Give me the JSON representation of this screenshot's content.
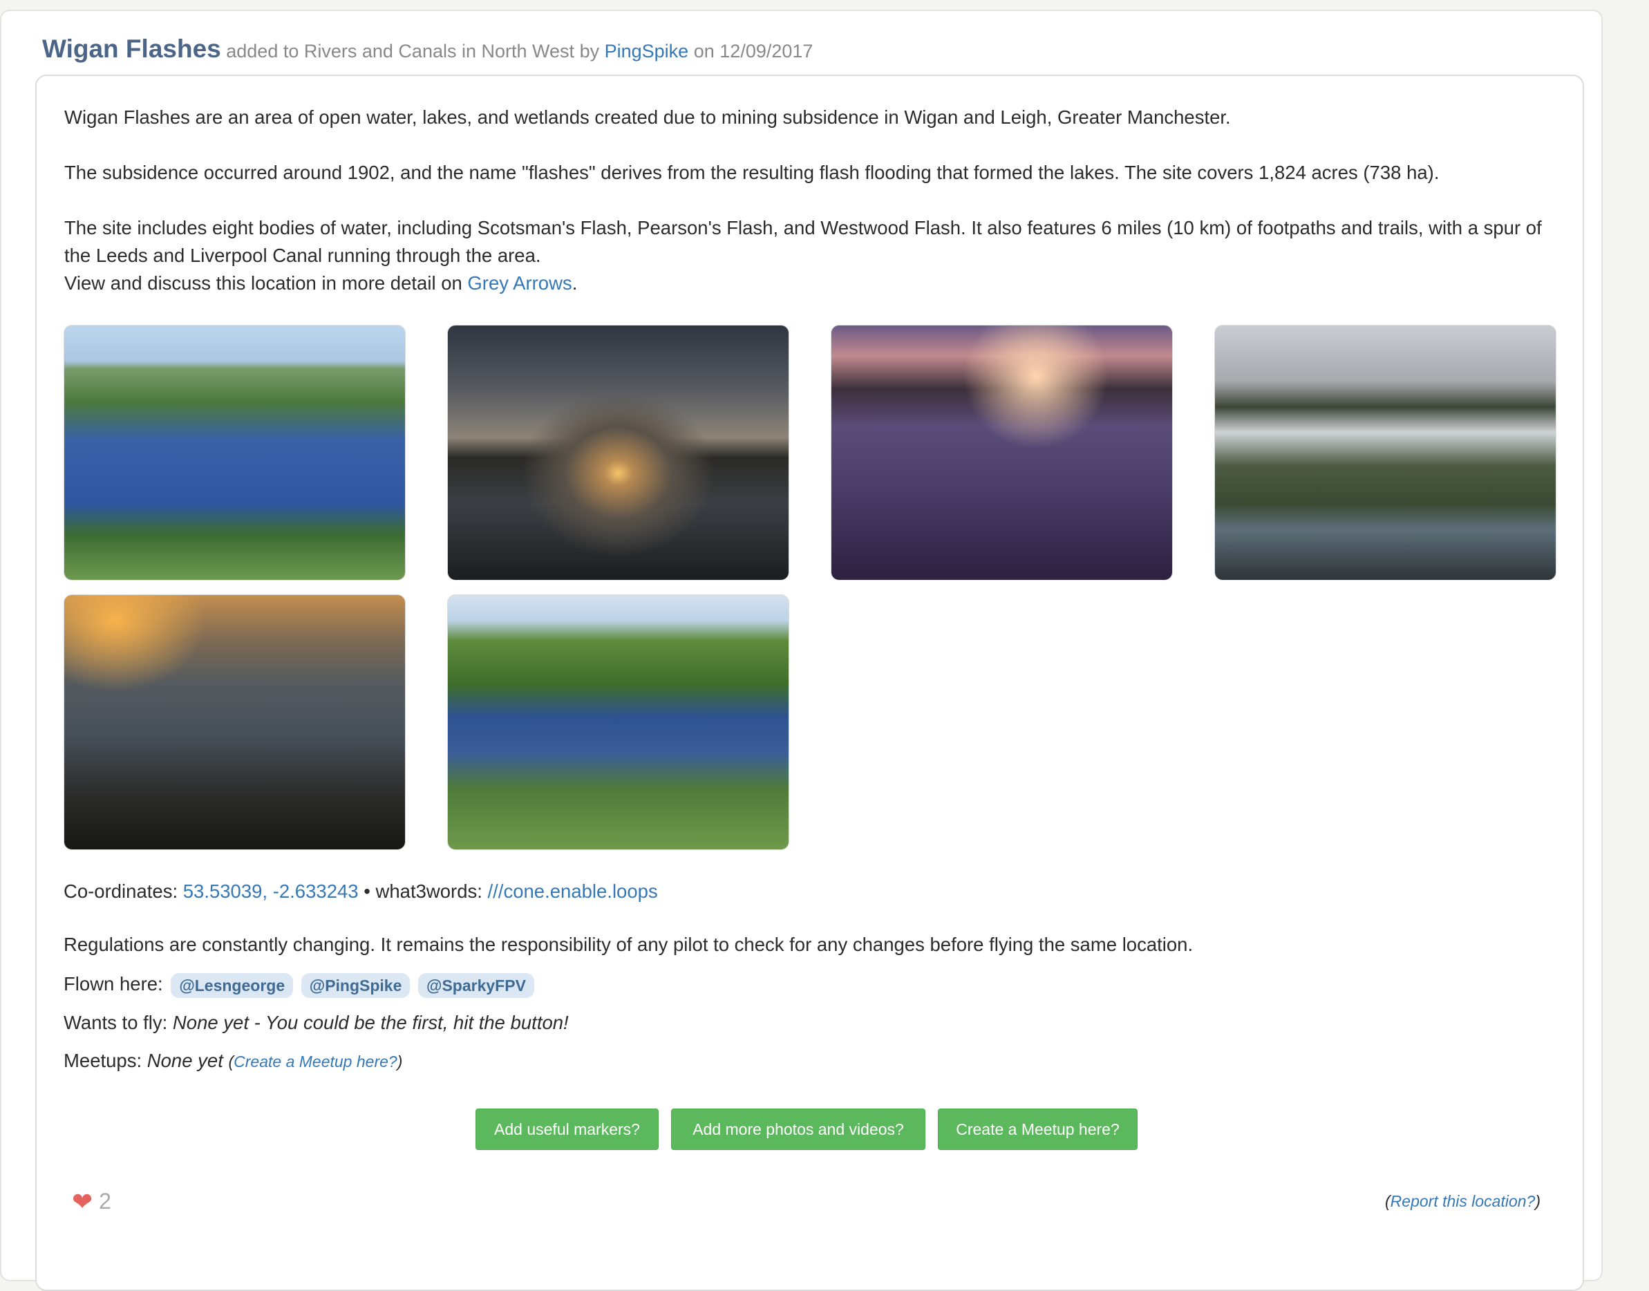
{
  "header": {
    "title": "Wigan Flashes",
    "added_to_prefix": "added to",
    "category": "Rivers and Canals in North West",
    "by_text": "by",
    "author": "PingSpike",
    "on_text": "on",
    "date": "12/09/2017"
  },
  "description": {
    "p1": "Wigan Flashes are an area of open water, lakes, and wetlands created due to mining subsidence in Wigan and Leigh, Greater Manchester.",
    "p2": "The subsidence occurred around 1902, and the name \"flashes\" derives from the resulting flash flooding that formed the lakes. The site covers 1,824 acres (738 ha).",
    "p3": "The site includes eight bodies of water, including Scotsman's Flash, Pearson's Flash, and Westwood Flash. It also features 6 miles (10 km) of footpaths and trails, with a spur of the Leeds and Liverpool Canal running through the area.",
    "view_prefix": "View and discuss this location in more detail on",
    "view_link": "Grey Arrows",
    "view_suffix": "."
  },
  "photos": [
    {
      "subject": "aerial canal and lake"
    },
    {
      "subject": "sunset over lake"
    },
    {
      "subject": "purple dusk lake"
    },
    {
      "subject": "canal and flashes overcast"
    },
    {
      "subject": "sunrise over lake"
    },
    {
      "subject": "wetlands summer"
    }
  ],
  "details": {
    "coords_label": "Co-ordinates:",
    "coords_value": "53.53039, -2.633243",
    "separator": "•",
    "w3w_label": "what3words:",
    "w3w_value": "///cone.enable.loops",
    "regulations": "Regulations are constantly changing. It remains the responsibility of any pilot to check for any changes before flying the same location.",
    "flown_label": "Flown here:",
    "flown_users": [
      "@Lesngeorge",
      "@PingSpike",
      "@SparkyFPV"
    ],
    "wants_label": "Wants to fly:",
    "wants_value": "None yet - You could be the first, hit the button!",
    "meetups_label": "Meetups:",
    "meetups_value": "None yet",
    "meetups_open": "(",
    "meetups_link": "Create a Meetup here?",
    "meetups_close": ")"
  },
  "buttons": {
    "markers": "Add useful markers?",
    "photos": "Add more photos and videos?",
    "meetup": "Create a Meetup here?"
  },
  "footer": {
    "likes": "2",
    "report_open": "(",
    "report_link": "Report this location?",
    "report_close": ")"
  },
  "colors": {
    "title": "#4b6589",
    "link": "#3478b8",
    "button": "#5cb85c",
    "heart": "#e2645c",
    "tag_bg": "#dbe8f4"
  }
}
